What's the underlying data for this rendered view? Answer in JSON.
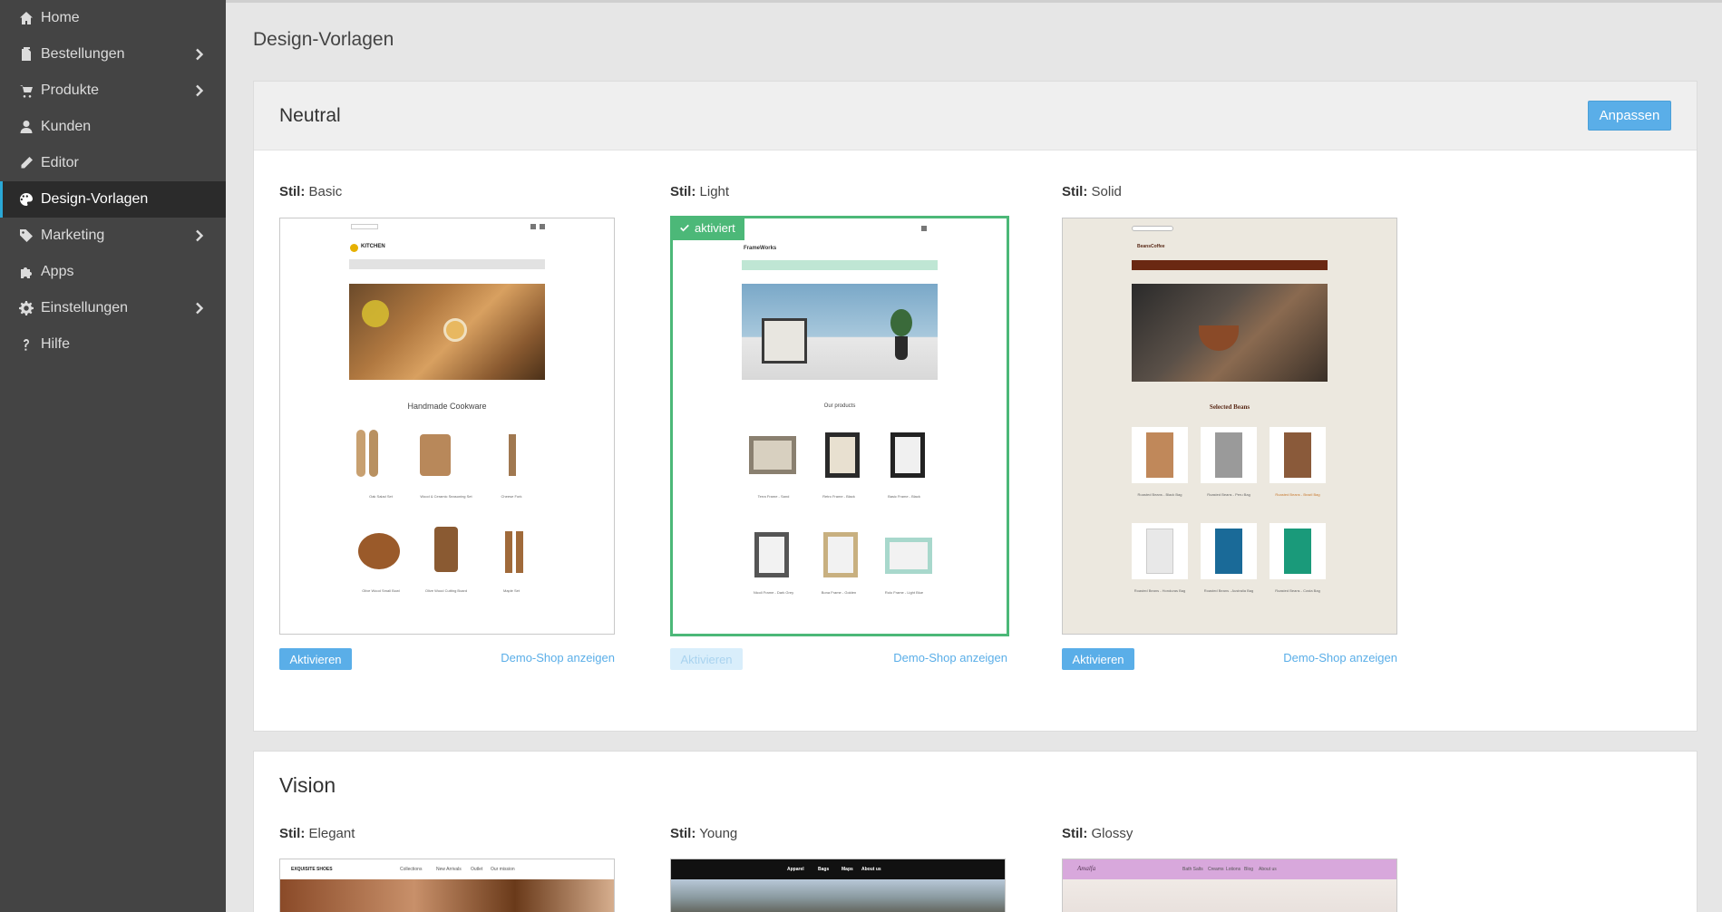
{
  "sidebar": {
    "items": [
      {
        "label": "Home",
        "icon": "home-icon",
        "chevron": false,
        "active": false
      },
      {
        "label": "Bestellungen",
        "icon": "clipboard-icon",
        "chevron": true,
        "active": false
      },
      {
        "label": "Produkte",
        "icon": "cart-icon",
        "chevron": true,
        "active": false
      },
      {
        "label": "Kunden",
        "icon": "user-icon",
        "chevron": false,
        "active": false
      },
      {
        "label": "Editor",
        "icon": "pencil-icon",
        "chevron": false,
        "active": false
      },
      {
        "label": "Design-Vorlagen",
        "icon": "palette-icon",
        "chevron": false,
        "active": true
      },
      {
        "label": "Marketing",
        "icon": "tag-icon",
        "chevron": true,
        "active": false
      },
      {
        "label": "Apps",
        "icon": "puzzle-icon",
        "chevron": false,
        "active": false
      },
      {
        "label": "Einstellungen",
        "icon": "gear-icon",
        "chevron": true,
        "active": false
      },
      {
        "label": "Hilfe",
        "icon": "question-icon",
        "chevron": false,
        "active": false
      }
    ]
  },
  "page": {
    "title": "Design-Vorlagen"
  },
  "colors": {
    "accent": "#5aaee8",
    "active_green": "#4cb878",
    "sidebar_bg": "#444444"
  },
  "neutral": {
    "title": "Neutral",
    "customize_label": "Anpassen",
    "styles": [
      {
        "prefix": "Stil:",
        "name": "Basic",
        "activate_label": "Aktivieren",
        "demo_label": "Demo-Shop anzeigen",
        "activated": false,
        "preview": {
          "brand": "KITCHEN",
          "heading": "Handmade Cookware",
          "products": [
            "Oak Salad Set",
            "Wood & Ceramic Seasoning Set",
            "Cheese Fork",
            "Olive Wood Small Bowl",
            "Olive Wood Cutting Board",
            "Maple Set"
          ]
        }
      },
      {
        "prefix": "Stil:",
        "name": "Light",
        "activate_label": "Aktivieren",
        "demo_label": "Demo-Shop anzeigen",
        "activated": true,
        "badge": "aktiviert",
        "preview": {
          "brand": "FrameWorks",
          "heading": "Our products",
          "products": [
            "Terra Frame - Sand",
            "Retro Frame - Black",
            "Basic Frame - Black",
            "Nicoli Frame - Dark Grey",
            "Bona Frame - Golden",
            "Rolo Frame - Light Blue"
          ]
        }
      },
      {
        "prefix": "Stil:",
        "name": "Solid",
        "activate_label": "Aktivieren",
        "demo_label": "Demo-Shop anzeigen",
        "activated": false,
        "preview": {
          "brand": "BeansCoffee",
          "heading": "Selected Beans",
          "products": [
            "Roasted Beans - Black Bag",
            "Roasted Beans - Peru Bag",
            "Roasted Beans - Brazil Bag",
            "Roasted Beans - Honduras Bag",
            "Roasted Beans - Australia Bag",
            "Roasted Beans - Costa Bag"
          ]
        }
      }
    ]
  },
  "vision": {
    "title": "Vision",
    "styles": [
      {
        "prefix": "Stil:",
        "name": "Elegant",
        "preview": {
          "brand": "EXQUISITE SHOES",
          "nav": [
            "Collections",
            "New Arrivals",
            "Outlet",
            "Our mission"
          ]
        }
      },
      {
        "prefix": "Stil:",
        "name": "Young",
        "preview": {
          "nav": [
            "Apparel",
            "Bags",
            "Maps",
            "About us"
          ]
        }
      },
      {
        "prefix": "Stil:",
        "name": "Glossy",
        "preview": {
          "brand": "Amalfa",
          "nav": [
            "Bath Salts",
            "Creams",
            "Lotions",
            "Blog",
            "About us"
          ]
        }
      }
    ]
  }
}
